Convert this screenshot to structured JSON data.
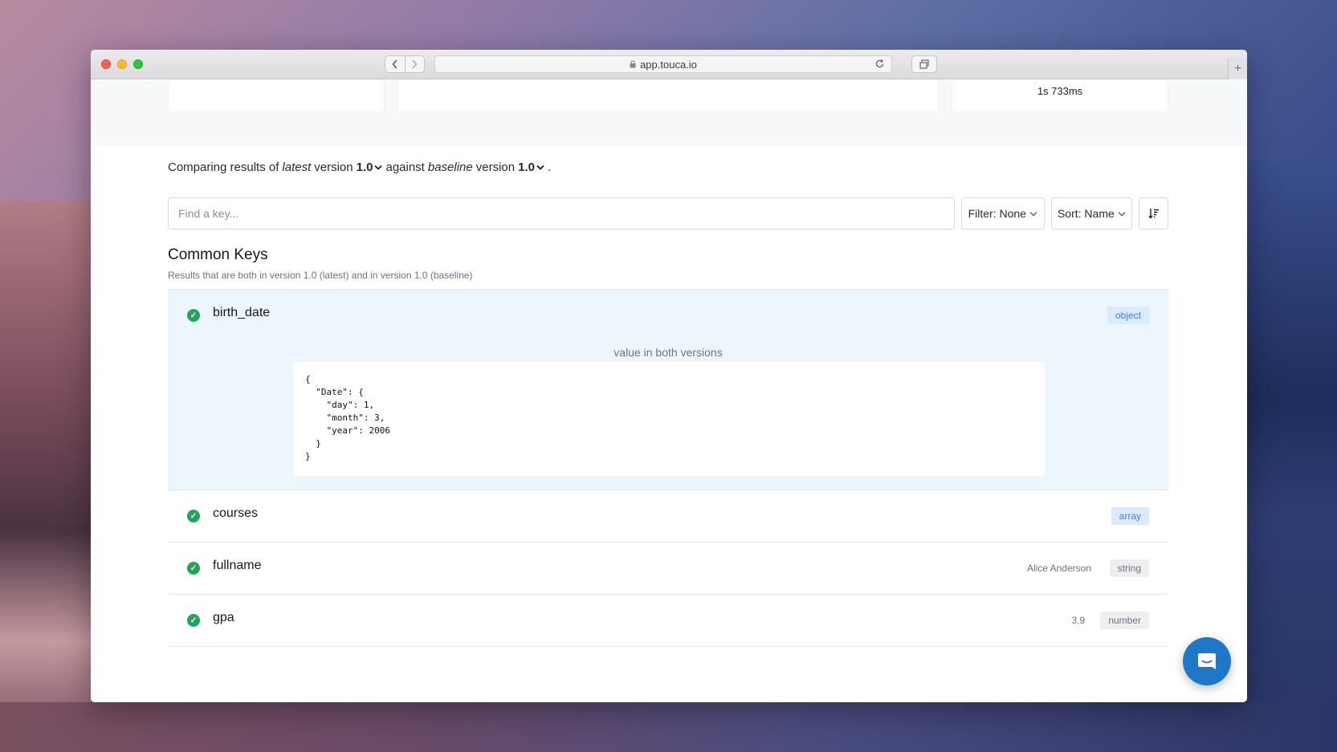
{
  "browser": {
    "url": "app.touca.io"
  },
  "stats": {
    "duration": "1s 733ms"
  },
  "compare": {
    "prefix": "Comparing results of",
    "latest_label": "latest",
    "version_word": "version",
    "latest_version": "1.0",
    "against": "against",
    "baseline_label": "baseline",
    "version_word2": "version",
    "baseline_version": "1.0",
    "suffix": "."
  },
  "search": {
    "placeholder": "Find a key..."
  },
  "controls": {
    "filter_label": "Filter: None",
    "sort_label": "Sort: Name"
  },
  "section": {
    "title": "Common Keys",
    "subtitle": "Results that are both in version 1.0 (latest) and in version 1.0 (baseline)"
  },
  "keys": [
    {
      "name": "birth_date",
      "type": "object",
      "caption": "value in both versions",
      "code": "{\n  \"Date\": {\n    \"day\": 1,\n    \"month\": 3,\n    \"year\": 2006\n  }\n}"
    },
    {
      "name": "courses",
      "type": "array"
    },
    {
      "name": "fullname",
      "type": "string",
      "value": "Alice Anderson"
    },
    {
      "name": "gpa",
      "type": "number",
      "value": "3.9"
    }
  ],
  "icons": {
    "check": "check-circle-icon",
    "sort_order": "sort-descending-icon",
    "chat": "chat-bubble-icon"
  },
  "colors": {
    "success": "#22a55b",
    "accent": "#1f78c7",
    "badge_blue_bg": "#dbeafe",
    "expanded_bg": "#eef6fd"
  }
}
